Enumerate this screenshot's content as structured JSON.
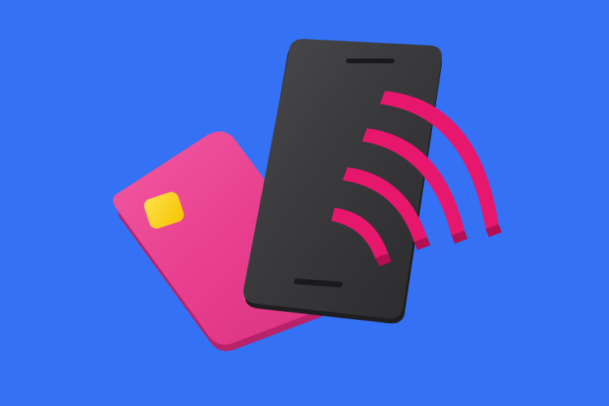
{
  "scene": {
    "background_color": "#3471F4",
    "subject": "contactless-payment-illustration",
    "objects": [
      {
        "name": "credit-card",
        "color": "#E83F8E",
        "icon": "credit-card-icon"
      },
      {
        "name": "card-chip",
        "color": "#FFD400",
        "icon": "chip-icon"
      },
      {
        "name": "smartphone",
        "color": "#3A3A3C",
        "icon": "smartphone-icon"
      },
      {
        "name": "contactless-waves",
        "color": "#E8176E",
        "icon": "contactless-wave-icon",
        "wave_count": 4
      }
    ]
  }
}
